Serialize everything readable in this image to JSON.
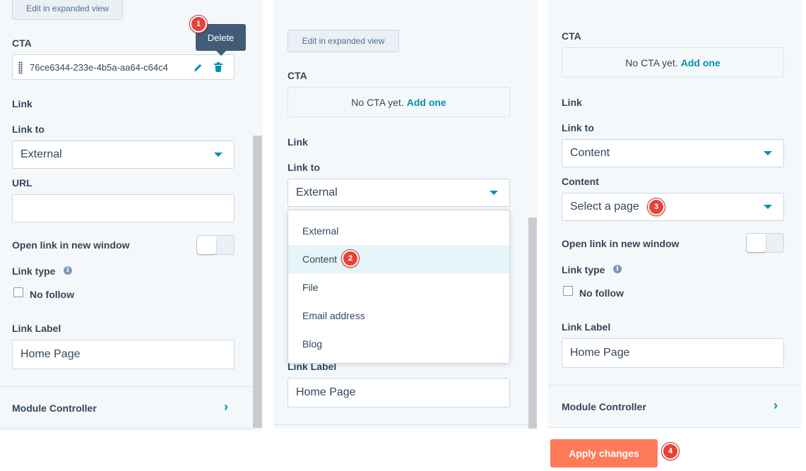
{
  "panel1": {
    "expanded_button": "Edit in expanded view",
    "cta_label": "CTA",
    "cta_value": "76ce6344-233e-4b5a-aa64-c64c4",
    "tooltip": "Delete",
    "link_heading": "Link",
    "link_to_label": "Link to",
    "link_to_value": "External",
    "url_label": "URL",
    "url_value": "",
    "new_window_label": "Open link in new window",
    "link_type_label": "Link type",
    "no_follow_label": "No follow",
    "link_label_label": "Link Label",
    "link_label_value": "Home Page",
    "module_controller": "Module Controller",
    "badge": "1"
  },
  "panel2": {
    "expanded_button": "Edit in expanded view",
    "cta_label": "CTA",
    "cta_empty": "No CTA yet.",
    "cta_add": "Add one",
    "link_heading": "Link",
    "link_to_label": "Link to",
    "link_to_value": "External",
    "dropdown_options": [
      "External",
      "Content",
      "File",
      "Email address",
      "Blog"
    ],
    "highlighted_option": "Content",
    "link_label_label": "Link Label",
    "link_label_value": "Home Page",
    "badge": "2"
  },
  "panel3": {
    "cta_label": "CTA",
    "cta_empty": "No CTA yet.",
    "cta_add": "Add one",
    "link_heading": "Link",
    "link_to_label": "Link to",
    "link_to_value": "Content",
    "content_label": "Content",
    "content_placeholder": "Select a page",
    "new_window_label": "Open link in new window",
    "link_type_label": "Link type",
    "no_follow_label": "No follow",
    "link_label_label": "Link Label",
    "link_label_value": "Home Page",
    "module_controller": "Module Controller",
    "badge": "3"
  },
  "apply": {
    "label": "Apply changes",
    "badge": "4"
  },
  "colors": {
    "accent": "#0091ae",
    "panel_bg": "#f5f8fa",
    "apply_bg": "#ff7a59",
    "badge_red": "#e8413a",
    "tooltip_bg": "#425b76"
  },
  "icons": [
    "pencil-icon",
    "trash-icon",
    "drag-handle-icon",
    "info-icon",
    "chevron-right-icon",
    "caret-down-icon"
  ]
}
